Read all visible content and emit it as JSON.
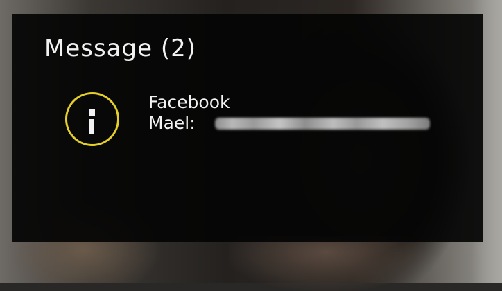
{
  "notification": {
    "title": "Message (2)",
    "icon": "info-icon",
    "icon_color": "#e5cf2a",
    "source": "Facebook",
    "sender": "Mael:",
    "message_text_redacted": true
  }
}
